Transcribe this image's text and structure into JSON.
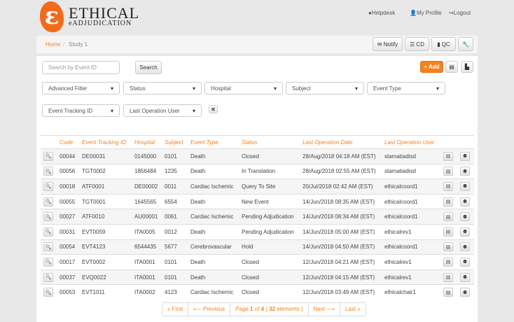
{
  "brand": {
    "name": "ETHICAL",
    "sub": "eADJUDICATION",
    "mark": "ε"
  },
  "top_links": {
    "helpdesk": "Helpdesk",
    "profile": "My Profile",
    "logout": "Logout"
  },
  "breadcrumb": {
    "home": "Home",
    "sep": "/",
    "current": "Study 1"
  },
  "toolbar": {
    "notify": "Notify",
    "cd": "CD",
    "qc": "QC"
  },
  "search": {
    "placeholder": "Search by Event ID",
    "button": "Search",
    "add": "+ Add"
  },
  "filters": [
    "Advanced Filter",
    "Status",
    "Hospital",
    "Subject",
    "Event Type",
    "Event Tracking ID",
    "Last Operation User"
  ],
  "table": {
    "headers": [
      "Code",
      "Event Tracking ID",
      "Hospital",
      "Subject",
      "Event Type",
      "Status",
      "Last Operation Date",
      "Last Operation User"
    ],
    "rows": [
      [
        "00044",
        "DE00031",
        "0145000",
        "0101",
        "Death",
        "Closed",
        "28/Aug/2018 04:18 AM (EST)",
        "stamatiadisd"
      ],
      [
        "00056",
        "TGT0002",
        "1856484",
        "1235",
        "Death",
        "In Translation",
        "28/Aug/2018 02:55 AM (EST)",
        "stamatiadisd"
      ],
      [
        "00018",
        "ATF0001",
        "DE00002",
        "0011",
        "Cardiac Ischemic",
        "Query To Site",
        "20/Jul/2018 02:42 AM (EST)",
        "ethicalcoord1"
      ],
      [
        "00055",
        "TGT0001",
        "1645565",
        "6554",
        "Death",
        "New Event",
        "14/Jun/2018 08:35 AM (EST)",
        "ethicalcoord1"
      ],
      [
        "00027",
        "ATF0010",
        "AU00001",
        "0061",
        "Cardiac Ischemic",
        "Pending Adjudication",
        "14/Jun/2018 08:34 AM (EST)",
        "ethicalcoord1"
      ],
      [
        "00031",
        "EVT0059",
        "ITA0005",
        "0012",
        "Death",
        "Pending Adjudication",
        "14/Jun/2018 05:00 AM (EST)",
        "ethicalrev1"
      ],
      [
        "00054",
        "EVT4123",
        "6544435",
        "5677",
        "Cerebrovascular",
        "Hold",
        "14/Jun/2018 04:50 AM (EST)",
        "ethicalcoord1"
      ],
      [
        "00017",
        "EVT0002",
        "ITA0001",
        "0101",
        "Death",
        "Closed",
        "12/Jun/2018 04:21 AM (EST)",
        "ethicalrev1"
      ],
      [
        "00037",
        "EVQ0022",
        "ITA0001",
        "0101",
        "Death",
        "Closed",
        "12/Jun/2018 04:15 AM (EST)",
        "ethicalrev1"
      ],
      [
        "00053",
        "EVT1011",
        "ITA0002",
        "4123",
        "Cardiac Ischemic",
        "Closed",
        "12/Jun/2018 03:49 AM (EST)",
        "ethicalchair1"
      ]
    ]
  },
  "pagination": {
    "first": "« First",
    "prev": "⟵ Previous",
    "page_label": "Page",
    "page": "1",
    "of": "of",
    "total_pages": "4",
    "open": "(",
    "count": "32",
    "elements": "elements )",
    "next": "Next ⟶",
    "last": "Last »"
  },
  "colors": {
    "accent": "#f58220"
  }
}
